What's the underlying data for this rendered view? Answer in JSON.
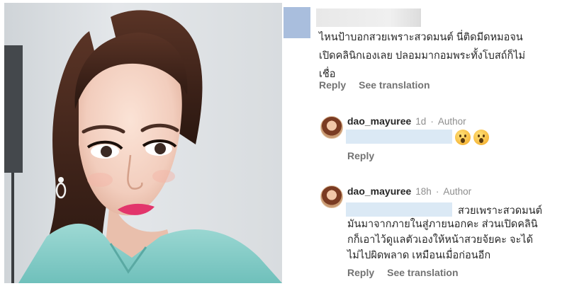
{
  "comment": {
    "text_lines": [
      "ไหนป้าบอกสวยเพราะสวดมนต์ นี่ติดมีดหมอจน",
      "เปิดคลินิกเองเลย ปลอมมากอมพระทั้งโบสถ์ก็ไม่",
      "เชื่อ"
    ],
    "reply_label": "Reply",
    "see_translation_label": "See translation"
  },
  "replies": [
    {
      "username": "dao_mayuree",
      "time": "1d",
      "separator": "·",
      "badge": "Author",
      "emojis": [
        "hushed-face-icon",
        "hushed-face-icon"
      ],
      "reply_label": "Reply"
    },
    {
      "username": "dao_mayuree",
      "time": "18h",
      "separator": "·",
      "badge": "Author",
      "text_first": "สวยเพราะสวดมนต์",
      "text_lines": [
        "มันมาจากภายในสู่ภายนอกคะ ส่วนเปิดคลินิ",
        "กก็เอาไว้ดูแลตัวเองให้หน้าสวยจ้ยคะ จะได้",
        "ไม่ไปผิดพลาด เหมือนเมื่อก่อนอีก"
      ],
      "reply_label": "Reply",
      "see_translation_label": "See translation"
    }
  ],
  "colors": {
    "text": "#262626",
    "meta": "#8e8e8e",
    "action": "#737373",
    "mention_blur": "#dbe9f5",
    "avatar_blur": "#a9bedd"
  }
}
